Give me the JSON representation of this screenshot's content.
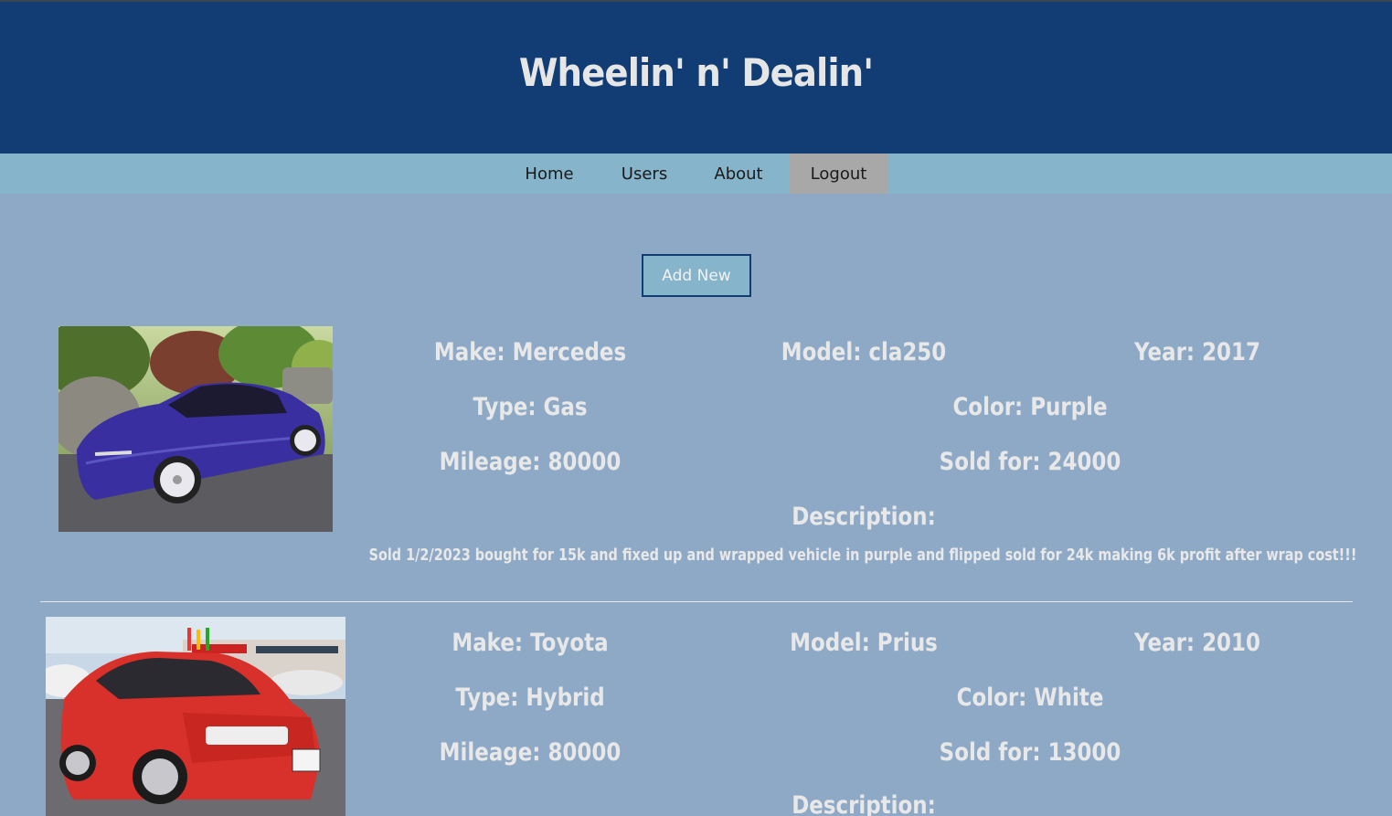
{
  "header": {
    "title": "Wheelin' n' Dealin'"
  },
  "nav": {
    "items": [
      {
        "label": "Home"
      },
      {
        "label": "Users"
      },
      {
        "label": "About"
      },
      {
        "label": "Logout"
      }
    ]
  },
  "actions": {
    "add_new_label": "Add New"
  },
  "colors": {
    "header_bg": "#123d74",
    "nav_bg": "#86b5cb",
    "page_bg": "#8ea9c6",
    "active_nav_bg": "#a8a8a8",
    "text": "#e8e8e8"
  },
  "cars": [
    {
      "make": "Make: Mercedes",
      "model": "Model: cla250",
      "year": "Year: 2017",
      "type": "Type: Gas",
      "color": "Color: Purple",
      "mileage": "Mileage: 80000",
      "sold_for": "Sold for: 24000",
      "description_label": "Description:",
      "description": "Sold 1/2/2023 bought for 15k and fixed up and wrapped vehicle in purple and flipped sold for 24k making 6k profit after wrap cost!!!"
    },
    {
      "make": "Make: Toyota",
      "model": "Model: Prius",
      "year": "Year: 2010",
      "type": "Type: Hybrid",
      "color": "Color: White",
      "mileage": "Mileage: 80000",
      "sold_for": "Sold for: 13000",
      "description_label": "Description:"
    }
  ]
}
